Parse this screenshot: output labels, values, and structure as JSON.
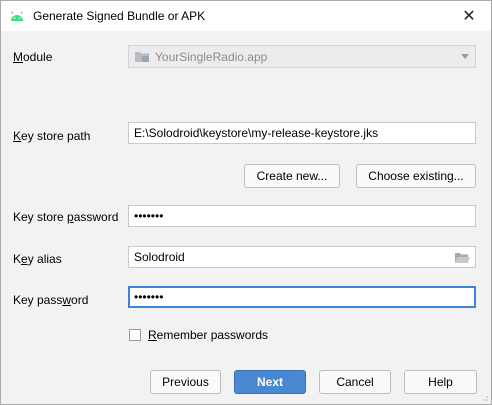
{
  "window": {
    "title": "Generate Signed Bundle or APK",
    "close_glyph": "✕"
  },
  "form": {
    "module": {
      "label": "Module",
      "value": "YourSingleRadio.app"
    },
    "keystore_path": {
      "label": "Key store path",
      "value": "E:\\Solodroid\\keystore\\my-release-keystore.jks"
    },
    "create_new_label": "Create new...",
    "choose_existing_label": "Choose existing...",
    "keystore_password": {
      "label": "Key store password",
      "value": "•••••••"
    },
    "key_alias": {
      "label": "Key alias",
      "value": "Solodroid"
    },
    "key_password": {
      "label": "Key password",
      "value": "•••••••"
    },
    "remember_passwords": {
      "label": "Remember passwords",
      "checked": false
    }
  },
  "buttons": {
    "previous": "Previous",
    "next": "Next",
    "cancel": "Cancel",
    "help": "Help"
  },
  "colors": {
    "android_icon": "#3ddc84",
    "primary_button": "#4a88d3",
    "focus_border": "#3d83d8"
  }
}
